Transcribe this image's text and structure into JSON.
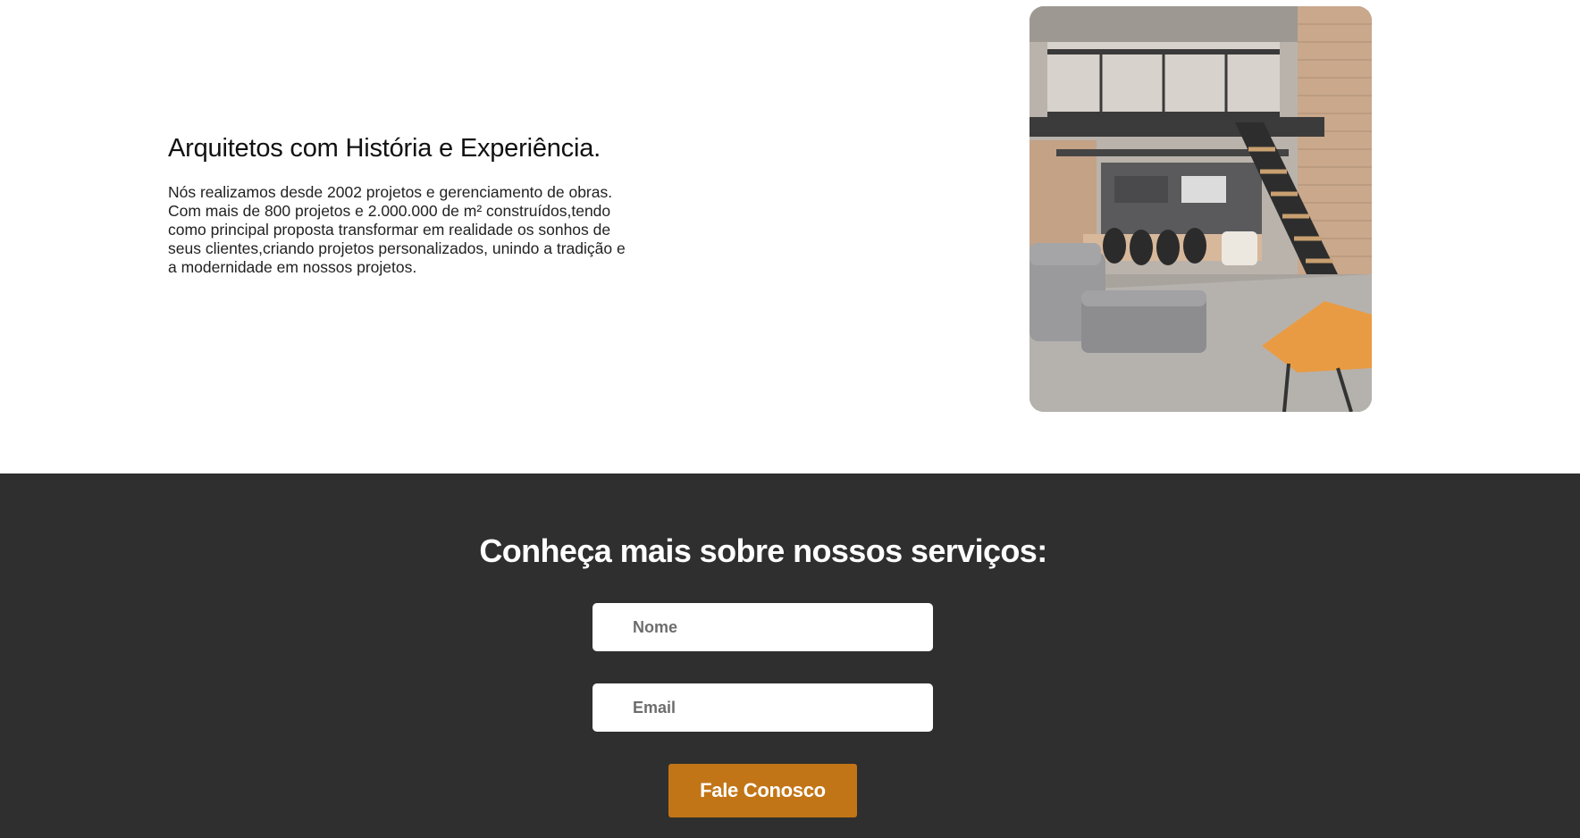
{
  "about": {
    "title": "Arquitetos com História e Experiência.",
    "body": "Nós realizamos desde 2002 projetos e gerenciamento de obras. Com mais de 800 projetos e 2.000.000 de m² construídos,tendo como principal proposta transformar em realidade os sonhos de seus clientes,criando projetos personalizados, unindo a tradição e a modernidade em nossos projetos."
  },
  "contact": {
    "title": "Conheça mais sobre nossos serviços:",
    "name_placeholder": "Nome",
    "email_placeholder": "Email",
    "submit_label": "Fale Conosco"
  },
  "colors": {
    "dark_background": "#2f2f2f",
    "accent": "#c27517",
    "text": "#111111"
  }
}
